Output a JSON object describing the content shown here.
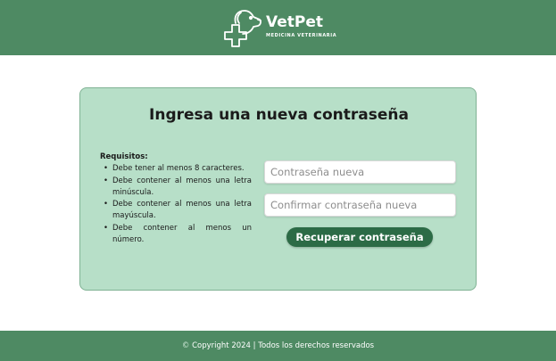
{
  "header": {
    "brand": "VetPet",
    "tagline": "MEDICINA VETERINARIA",
    "logo_icon": "dog-cross-logo-icon"
  },
  "card": {
    "title": "Ingresa una nueva contraseña",
    "requirements": {
      "title": "Requisitos:",
      "items": [
        "Debe tener al menos 8 caracteres.",
        "Debe contener al menos una letra minúscula.",
        "Debe contener al menos una letra mayúscula.",
        "Debe contener al menos un número."
      ]
    },
    "new_password": {
      "placeholder": "Contraseña nueva",
      "value": ""
    },
    "confirm_password": {
      "placeholder": "Confirmar contraseña nueva",
      "value": ""
    },
    "submit_label": "Recuperar contraseña"
  },
  "footer": {
    "copyright_symbol": "©",
    "text": "Copyright 2024 | Todos los derechos reservados"
  },
  "colors": {
    "header_bg": "#4e8a63",
    "card_bg": "#b7dfc8",
    "button_bg": "#2c6b46"
  }
}
